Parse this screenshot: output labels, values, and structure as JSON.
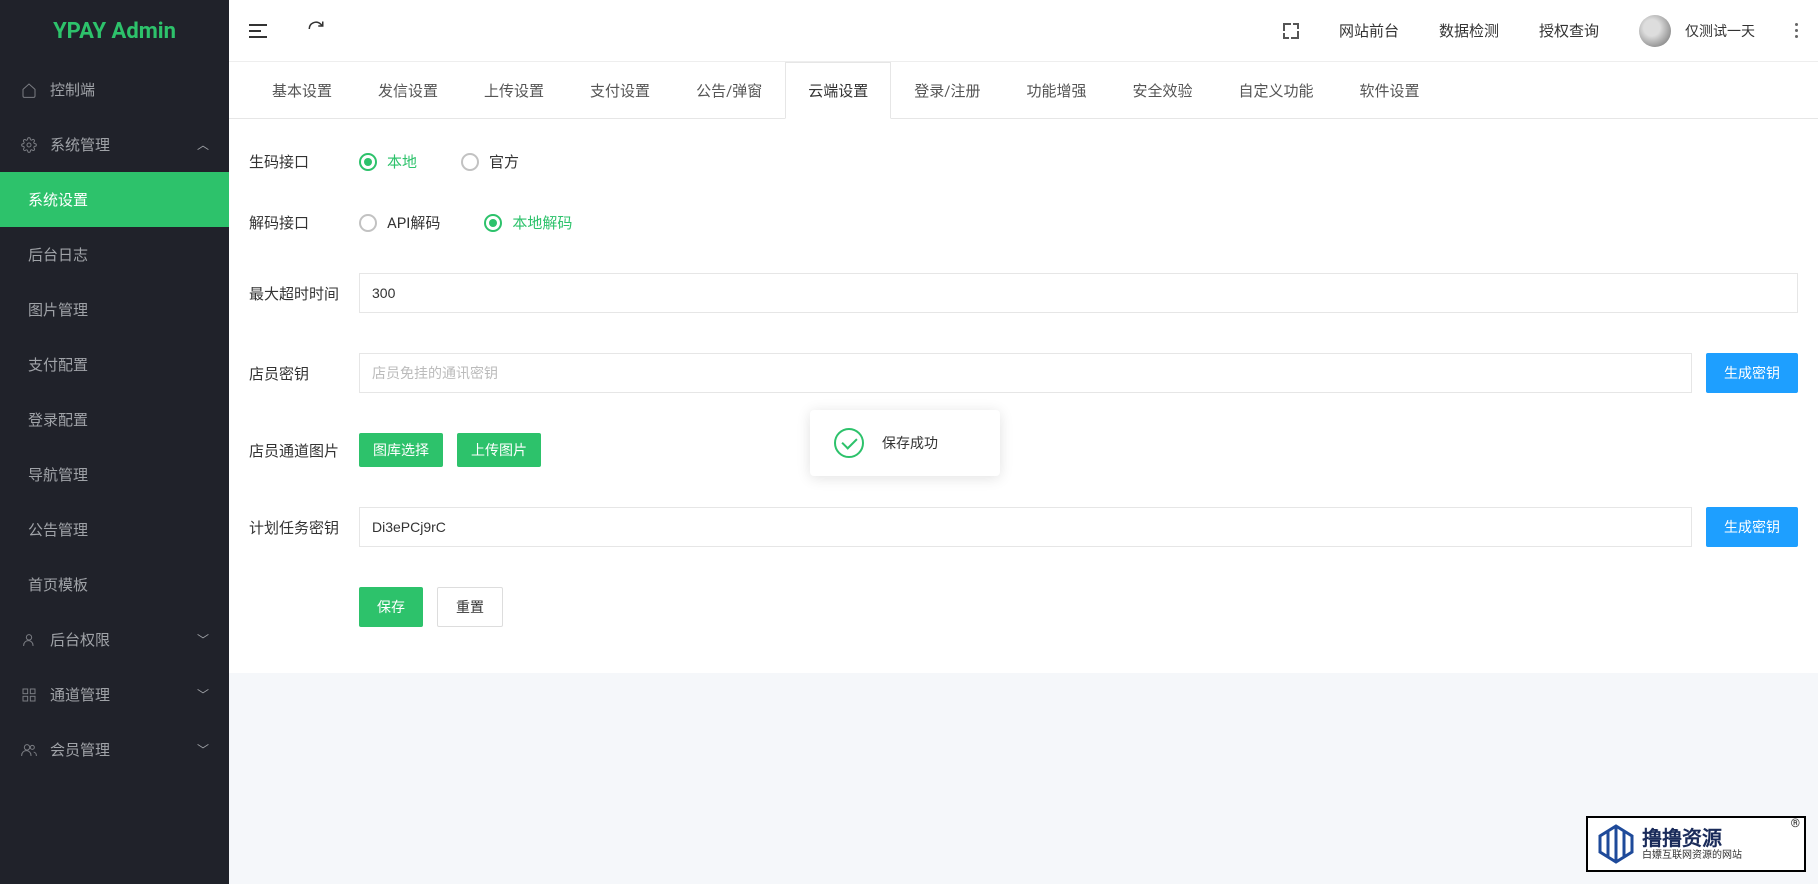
{
  "brand": "YPAY Admin",
  "sidebar": {
    "items": [
      {
        "label": "控制端",
        "icon": "home"
      },
      {
        "label": "系统管理",
        "icon": "gear",
        "expanded": true,
        "children": [
          {
            "label": "系统设置",
            "active": true
          },
          {
            "label": "后台日志"
          },
          {
            "label": "图片管理"
          },
          {
            "label": "支付配置"
          },
          {
            "label": "登录配置"
          },
          {
            "label": "导航管理"
          },
          {
            "label": "公告管理"
          },
          {
            "label": "首页模板"
          }
        ]
      },
      {
        "label": "后台权限",
        "icon": "user"
      },
      {
        "label": "通道管理",
        "icon": "grid"
      },
      {
        "label": "会员管理",
        "icon": "users"
      }
    ]
  },
  "header": {
    "links": [
      "网站前台",
      "数据检测",
      "授权查询"
    ],
    "user": "仅测试一天"
  },
  "tabs": [
    "基本设置",
    "发信设置",
    "上传设置",
    "支付设置",
    "公告/弹窗",
    "云端设置",
    "登录/注册",
    "功能增强",
    "安全效验",
    "自定义功能",
    "软件设置"
  ],
  "active_tab_index": 5,
  "form": {
    "code_api": {
      "label": "生码接口",
      "options": [
        "本地",
        "官方"
      ],
      "selected": 0
    },
    "decode_api": {
      "label": "解码接口",
      "options": [
        "API解码",
        "本地解码"
      ],
      "selected": 1
    },
    "timeout": {
      "label": "最大超时时间",
      "value": "300"
    },
    "clerk_key": {
      "label": "店员密钥",
      "placeholder": "店员免挂的通讯密钥",
      "value": "",
      "btn": "生成密钥"
    },
    "channel_img": {
      "label": "店员通道图片",
      "btn1": "图库选择",
      "btn2": "上传图片"
    },
    "task_key": {
      "label": "计划任务密钥",
      "value": "Di3ePCj9rC",
      "btn": "生成密钥"
    },
    "actions": {
      "save": "保存",
      "reset": "重置"
    }
  },
  "toast": {
    "message": "保存成功"
  },
  "watermark": {
    "title": "撸撸资源",
    "sub": "白嫖互联网资源的网站"
  }
}
